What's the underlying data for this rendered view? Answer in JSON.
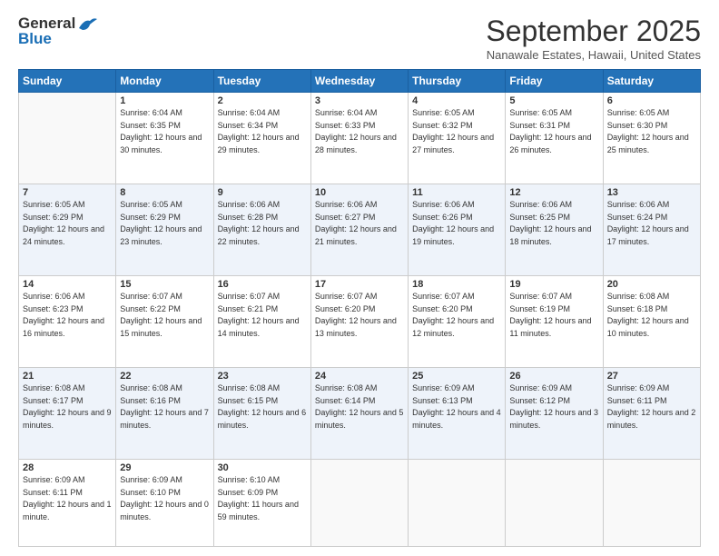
{
  "logo": {
    "line1": "General",
    "line2": "Blue"
  },
  "title": "September 2025",
  "location": "Nanawale Estates, Hawaii, United States",
  "weekdays": [
    "Sunday",
    "Monday",
    "Tuesday",
    "Wednesday",
    "Thursday",
    "Friday",
    "Saturday"
  ],
  "weeks": [
    [
      {
        "day": "",
        "sunrise": "",
        "sunset": "",
        "daylight": ""
      },
      {
        "day": "1",
        "sunrise": "Sunrise: 6:04 AM",
        "sunset": "Sunset: 6:35 PM",
        "daylight": "Daylight: 12 hours and 30 minutes."
      },
      {
        "day": "2",
        "sunrise": "Sunrise: 6:04 AM",
        "sunset": "Sunset: 6:34 PM",
        "daylight": "Daylight: 12 hours and 29 minutes."
      },
      {
        "day": "3",
        "sunrise": "Sunrise: 6:04 AM",
        "sunset": "Sunset: 6:33 PM",
        "daylight": "Daylight: 12 hours and 28 minutes."
      },
      {
        "day": "4",
        "sunrise": "Sunrise: 6:05 AM",
        "sunset": "Sunset: 6:32 PM",
        "daylight": "Daylight: 12 hours and 27 minutes."
      },
      {
        "day": "5",
        "sunrise": "Sunrise: 6:05 AM",
        "sunset": "Sunset: 6:31 PM",
        "daylight": "Daylight: 12 hours and 26 minutes."
      },
      {
        "day": "6",
        "sunrise": "Sunrise: 6:05 AM",
        "sunset": "Sunset: 6:30 PM",
        "daylight": "Daylight: 12 hours and 25 minutes."
      }
    ],
    [
      {
        "day": "7",
        "sunrise": "Sunrise: 6:05 AM",
        "sunset": "Sunset: 6:29 PM",
        "daylight": "Daylight: 12 hours and 24 minutes."
      },
      {
        "day": "8",
        "sunrise": "Sunrise: 6:05 AM",
        "sunset": "Sunset: 6:29 PM",
        "daylight": "Daylight: 12 hours and 23 minutes."
      },
      {
        "day": "9",
        "sunrise": "Sunrise: 6:06 AM",
        "sunset": "Sunset: 6:28 PM",
        "daylight": "Daylight: 12 hours and 22 minutes."
      },
      {
        "day": "10",
        "sunrise": "Sunrise: 6:06 AM",
        "sunset": "Sunset: 6:27 PM",
        "daylight": "Daylight: 12 hours and 21 minutes."
      },
      {
        "day": "11",
        "sunrise": "Sunrise: 6:06 AM",
        "sunset": "Sunset: 6:26 PM",
        "daylight": "Daylight: 12 hours and 19 minutes."
      },
      {
        "day": "12",
        "sunrise": "Sunrise: 6:06 AM",
        "sunset": "Sunset: 6:25 PM",
        "daylight": "Daylight: 12 hours and 18 minutes."
      },
      {
        "day": "13",
        "sunrise": "Sunrise: 6:06 AM",
        "sunset": "Sunset: 6:24 PM",
        "daylight": "Daylight: 12 hours and 17 minutes."
      }
    ],
    [
      {
        "day": "14",
        "sunrise": "Sunrise: 6:06 AM",
        "sunset": "Sunset: 6:23 PM",
        "daylight": "Daylight: 12 hours and 16 minutes."
      },
      {
        "day": "15",
        "sunrise": "Sunrise: 6:07 AM",
        "sunset": "Sunset: 6:22 PM",
        "daylight": "Daylight: 12 hours and 15 minutes."
      },
      {
        "day": "16",
        "sunrise": "Sunrise: 6:07 AM",
        "sunset": "Sunset: 6:21 PM",
        "daylight": "Daylight: 12 hours and 14 minutes."
      },
      {
        "day": "17",
        "sunrise": "Sunrise: 6:07 AM",
        "sunset": "Sunset: 6:20 PM",
        "daylight": "Daylight: 12 hours and 13 minutes."
      },
      {
        "day": "18",
        "sunrise": "Sunrise: 6:07 AM",
        "sunset": "Sunset: 6:20 PM",
        "daylight": "Daylight: 12 hours and 12 minutes."
      },
      {
        "day": "19",
        "sunrise": "Sunrise: 6:07 AM",
        "sunset": "Sunset: 6:19 PM",
        "daylight": "Daylight: 12 hours and 11 minutes."
      },
      {
        "day": "20",
        "sunrise": "Sunrise: 6:08 AM",
        "sunset": "Sunset: 6:18 PM",
        "daylight": "Daylight: 12 hours and 10 minutes."
      }
    ],
    [
      {
        "day": "21",
        "sunrise": "Sunrise: 6:08 AM",
        "sunset": "Sunset: 6:17 PM",
        "daylight": "Daylight: 12 hours and 9 minutes."
      },
      {
        "day": "22",
        "sunrise": "Sunrise: 6:08 AM",
        "sunset": "Sunset: 6:16 PM",
        "daylight": "Daylight: 12 hours and 7 minutes."
      },
      {
        "day": "23",
        "sunrise": "Sunrise: 6:08 AM",
        "sunset": "Sunset: 6:15 PM",
        "daylight": "Daylight: 12 hours and 6 minutes."
      },
      {
        "day": "24",
        "sunrise": "Sunrise: 6:08 AM",
        "sunset": "Sunset: 6:14 PM",
        "daylight": "Daylight: 12 hours and 5 minutes."
      },
      {
        "day": "25",
        "sunrise": "Sunrise: 6:09 AM",
        "sunset": "Sunset: 6:13 PM",
        "daylight": "Daylight: 12 hours and 4 minutes."
      },
      {
        "day": "26",
        "sunrise": "Sunrise: 6:09 AM",
        "sunset": "Sunset: 6:12 PM",
        "daylight": "Daylight: 12 hours and 3 minutes."
      },
      {
        "day": "27",
        "sunrise": "Sunrise: 6:09 AM",
        "sunset": "Sunset: 6:11 PM",
        "daylight": "Daylight: 12 hours and 2 minutes."
      }
    ],
    [
      {
        "day": "28",
        "sunrise": "Sunrise: 6:09 AM",
        "sunset": "Sunset: 6:11 PM",
        "daylight": "Daylight: 12 hours and 1 minute."
      },
      {
        "day": "29",
        "sunrise": "Sunrise: 6:09 AM",
        "sunset": "Sunset: 6:10 PM",
        "daylight": "Daylight: 12 hours and 0 minutes."
      },
      {
        "day": "30",
        "sunrise": "Sunrise: 6:10 AM",
        "sunset": "Sunset: 6:09 PM",
        "daylight": "Daylight: 11 hours and 59 minutes."
      },
      {
        "day": "",
        "sunrise": "",
        "sunset": "",
        "daylight": ""
      },
      {
        "day": "",
        "sunrise": "",
        "sunset": "",
        "daylight": ""
      },
      {
        "day": "",
        "sunrise": "",
        "sunset": "",
        "daylight": ""
      },
      {
        "day": "",
        "sunrise": "",
        "sunset": "",
        "daylight": ""
      }
    ]
  ]
}
